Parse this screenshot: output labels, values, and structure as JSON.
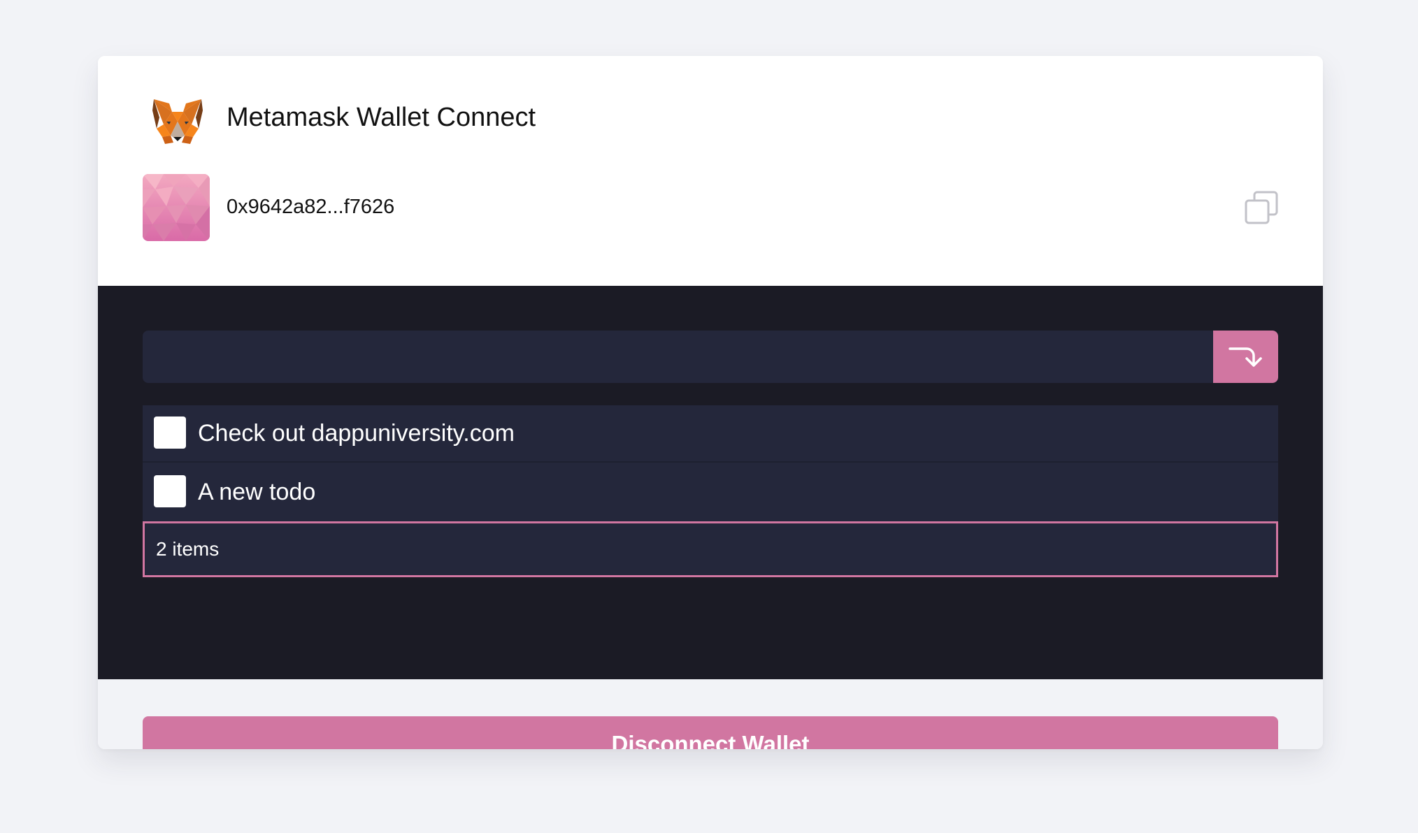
{
  "header": {
    "title": "Metamask Wallet Connect",
    "logo_icon": "metamask-fox-icon",
    "address": "0x9642a82...f7626",
    "copy_icon": "copy-icon"
  },
  "todo": {
    "input_value": "",
    "input_placeholder": "",
    "submit_icon": "arrow-turn-down-icon",
    "items": [
      {
        "text": "Check out dappuniversity.com",
        "checked": false
      },
      {
        "text": "A new todo",
        "checked": false
      }
    ],
    "count_text": "2 items"
  },
  "footer": {
    "disconnect_label": "Disconnect Wallet"
  },
  "colors": {
    "accent": "#d176a1",
    "panel_bg": "#1b1b25",
    "row_bg": "#24273b",
    "page_bg": "#f2f3f7"
  }
}
